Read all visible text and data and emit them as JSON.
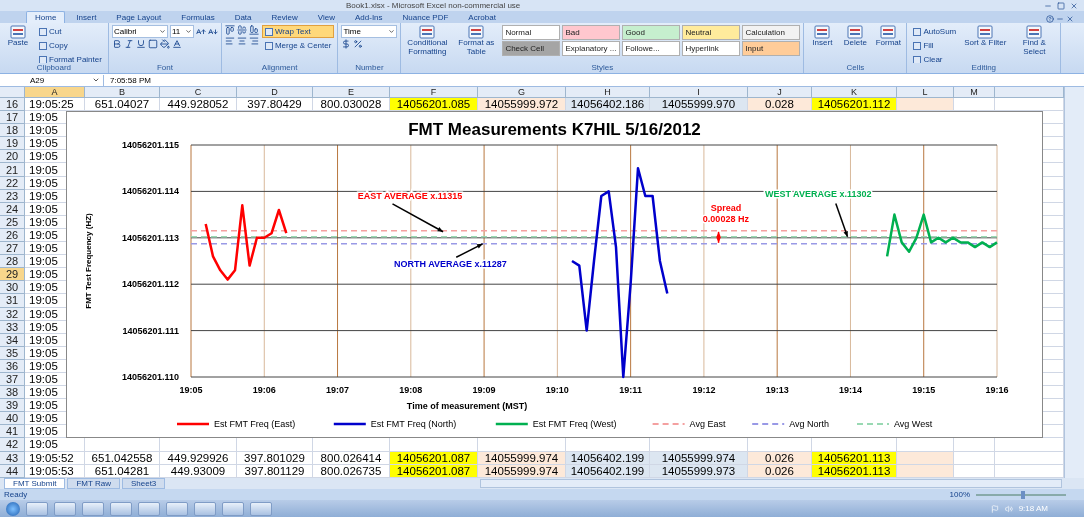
{
  "window": {
    "title": "Book1.xlsx - Microsoft Excel non-commercial use"
  },
  "ribbon": {
    "tabs": [
      {
        "label": "Home",
        "selected": true
      },
      {
        "label": "Insert",
        "selected": false
      },
      {
        "label": "Page Layout",
        "selected": false
      },
      {
        "label": "Formulas",
        "selected": false
      },
      {
        "label": "Data",
        "selected": false
      },
      {
        "label": "Review",
        "selected": false
      },
      {
        "label": "View",
        "selected": false
      },
      {
        "label": "Add-Ins",
        "selected": false
      },
      {
        "label": "Nuance PDF",
        "selected": false
      },
      {
        "label": "Acrobat",
        "selected": false
      }
    ],
    "groups": [
      {
        "label": "Clipboard",
        "items": [
          {
            "kind": "large",
            "label": "Paste"
          },
          {
            "kind": "stack",
            "children": [
              {
                "kind": "small",
                "label": "Cut"
              },
              {
                "kind": "small",
                "label": "Copy"
              },
              {
                "kind": "small",
                "label": "Format Painter"
              }
            ]
          }
        ]
      },
      {
        "label": "Font",
        "items": [
          {
            "kind": "stack",
            "children": [
              {
                "kind": "row",
                "children": [
                  {
                    "kind": "field",
                    "value": "Calibri",
                    "wide": true
                  },
                  {
                    "kind": "field",
                    "value": "11",
                    "wide": false
                  },
                  {
                    "kind": "grow_icons"
                  }
                ]
              },
              {
                "kind": "font_icons"
              }
            ]
          }
        ]
      },
      {
        "label": "Alignment",
        "items": [
          {
            "kind": "stack",
            "children": [
              {
                "kind": "valign_icons"
              },
              {
                "kind": "halign_icons"
              }
            ]
          },
          {
            "kind": "stack",
            "children": [
              {
                "kind": "small",
                "label": "Wrap Text",
                "on": true
              },
              {
                "kind": "small",
                "label": "Merge & Center",
                "on": false
              }
            ]
          }
        ]
      },
      {
        "label": "Number",
        "items": [
          {
            "kind": "stack",
            "children": [
              {
                "kind": "field",
                "value": "Time",
                "wide": true
              },
              {
                "kind": "number_icons"
              }
            ]
          }
        ]
      },
      {
        "label": "Styles",
        "items": [
          {
            "kind": "large",
            "label": "Conditional Formatting"
          },
          {
            "kind": "large",
            "label": "Format as Table"
          },
          {
            "kind": "stack",
            "children": [
              {
                "kind": "row",
                "children": [
                  {
                    "kind": "style",
                    "label": "Normal",
                    "color": "#ffffff"
                  },
                  {
                    "kind": "style",
                    "label": "Bad",
                    "color": "#ffc7ce"
                  },
                  {
                    "kind": "style",
                    "label": "Good",
                    "color": "#c6efce"
                  },
                  {
                    "kind": "style",
                    "label": "Neutral",
                    "color": "#ffeb9c"
                  },
                  {
                    "kind": "style",
                    "label": "Calculation",
                    "color": "#f2f2f2"
                  }
                ]
              },
              {
                "kind": "row",
                "children": [
                  {
                    "kind": "style",
                    "label": "Check Cell",
                    "color": "#a5a5a5"
                  },
                  {
                    "kind": "style",
                    "label": "Explanatory ...",
                    "color": "#ffffff"
                  },
                  {
                    "kind": "style",
                    "label": "Followe...",
                    "color": "#ffffff"
                  },
                  {
                    "kind": "style",
                    "label": "Hyperlink",
                    "color": "#ffffff"
                  },
                  {
                    "kind": "style",
                    "label": "Input",
                    "color": "#ffcc99"
                  }
                ]
              }
            ]
          }
        ]
      },
      {
        "label": "Cells",
        "items": [
          {
            "kind": "large",
            "label": "Insert"
          },
          {
            "kind": "large",
            "label": "Delete"
          },
          {
            "kind": "large",
            "label": "Format"
          }
        ]
      },
      {
        "label": "Editing",
        "items": [
          {
            "kind": "stack",
            "children": [
              {
                "kind": "small",
                "label": "AutoSum"
              },
              {
                "kind": "small",
                "label": "Fill"
              },
              {
                "kind": "small",
                "label": "Clear"
              }
            ]
          },
          {
            "kind": "large",
            "label": "Sort & Filter"
          },
          {
            "kind": "large",
            "label": "Find & Select"
          }
        ]
      }
    ]
  },
  "formula_bar": {
    "name_box": "A29",
    "formula": "7:05:58 PM"
  },
  "sheet": {
    "columns": [
      {
        "letter": "A",
        "selected": true
      },
      {
        "letter": "B",
        "selected": false
      },
      {
        "letter": "C",
        "selected": false
      },
      {
        "letter": "D",
        "selected": false
      },
      {
        "letter": "E",
        "selected": false
      },
      {
        "letter": "F",
        "selected": false,
        "color": "#ffff00"
      },
      {
        "letter": "G",
        "selected": false,
        "color": "#fde9d9"
      },
      {
        "letter": "H",
        "selected": false,
        "color": "#dce6f1"
      },
      {
        "letter": "I",
        "selected": false,
        "color": "#dce6f1"
      },
      {
        "letter": "J",
        "selected": false,
        "color": "#fde9d9"
      },
      {
        "letter": "K",
        "selected": false,
        "color": "#ffff00"
      },
      {
        "letter": "L",
        "selected": false,
        "color": "#fde9d9"
      },
      {
        "letter": "M",
        "selected": false
      }
    ],
    "rows": [
      {
        "number": "16",
        "selected": false,
        "cells": [
          "19:05:25",
          "651.04027",
          "449.928052",
          "397.80429",
          "800.030028",
          "14056201.085",
          "14055999.972",
          "14056402.186",
          "14055999.970",
          "0.028",
          "14056201.112"
        ]
      },
      {
        "number": "17",
        "selected": false,
        "cells": [
          "19:05"
        ]
      },
      {
        "number": "18",
        "selected": false,
        "cells": [
          "19:05"
        ]
      },
      {
        "number": "19",
        "selected": false,
        "cells": [
          "19:05"
        ]
      },
      {
        "number": "20",
        "selected": false,
        "cells": [
          "19:05"
        ]
      },
      {
        "number": "21",
        "selected": false,
        "cells": [
          "19:05"
        ]
      },
      {
        "number": "22",
        "selected": false,
        "cells": [
          "19:05"
        ]
      },
      {
        "number": "23",
        "selected": false,
        "cells": [
          "19:05"
        ]
      },
      {
        "number": "24",
        "selected": false,
        "cells": [
          "19:05"
        ]
      },
      {
        "number": "25",
        "selected": false,
        "cells": [
          "19:05"
        ]
      },
      {
        "number": "26",
        "selected": false,
        "cells": [
          "19:05"
        ]
      },
      {
        "number": "27",
        "selected": false,
        "cells": [
          "19:05"
        ]
      },
      {
        "number": "28",
        "selected": false,
        "cells": [
          "19:05"
        ]
      },
      {
        "number": "29",
        "selected": true,
        "cells": [
          "19:05"
        ]
      },
      {
        "number": "30",
        "selected": false,
        "cells": [
          "19:05"
        ]
      },
      {
        "number": "31",
        "selected": false,
        "cells": [
          "19:05"
        ]
      },
      {
        "number": "32",
        "selected": false,
        "cells": [
          "19:05"
        ]
      },
      {
        "number": "33",
        "selected": false,
        "cells": [
          "19:05"
        ]
      },
      {
        "number": "34",
        "selected": false,
        "cells": [
          "19:05"
        ]
      },
      {
        "number": "35",
        "selected": false,
        "cells": [
          "19:05"
        ]
      },
      {
        "number": "36",
        "selected": false,
        "cells": [
          "19:05"
        ]
      },
      {
        "number": "37",
        "selected": false,
        "cells": [
          "19:05"
        ]
      },
      {
        "number": "38",
        "selected": false,
        "cells": [
          "19:05"
        ]
      },
      {
        "number": "39",
        "selected": false,
        "cells": [
          "19:05"
        ]
      },
      {
        "number": "40",
        "selected": false,
        "cells": [
          "19:05"
        ]
      },
      {
        "number": "41",
        "selected": false,
        "cells": [
          "19:05"
        ]
      },
      {
        "number": "42",
        "selected": false,
        "cells": [
          "19:05"
        ]
      },
      {
        "number": "43",
        "selected": false,
        "cells": [
          "19:05:52",
          "651.042558",
          "449.929926",
          "397.801029",
          "800.026414",
          "14056201.087",
          "14055999.974",
          "14056402.199",
          "14055999.974",
          "0.026",
          "14056201.113"
        ]
      },
      {
        "number": "44",
        "selected": false,
        "cells": [
          "19:05:53",
          "651.04281",
          "449.93009",
          "397.801129",
          "800.026735",
          "14056201.087",
          "14055999.974",
          "14056402.199",
          "14055999.973",
          "0.026",
          "14056201.113"
        ]
      }
    ],
    "chart_data": {
      "type": "line",
      "title": "FMT Measurements K7HIL 5/16/2012",
      "xlabel": "Time of measurement (MST)",
      "ylabel": "FMT Test Frequency (HZ)",
      "grid": true,
      "legend": "bottom",
      "ylim": [
        14056201.11,
        14056201.115
      ],
      "categories": [
        "19:05",
        null,
        null,
        null,
        null,
        null,
        null,
        null,
        null,
        null,
        "19:06",
        null,
        null,
        null,
        null,
        null,
        null,
        null,
        null,
        null,
        "19:07",
        null,
        null,
        null,
        null,
        null,
        null,
        null,
        null,
        null,
        "19:08",
        null,
        null,
        null,
        null,
        null,
        null,
        null,
        null,
        null,
        "19:09",
        null,
        null,
        null,
        null,
        null,
        null,
        null,
        null,
        null,
        "19:10",
        null,
        null,
        null,
        null,
        null,
        null,
        null,
        null,
        null,
        "19:11",
        null,
        null,
        null,
        null,
        null,
        null,
        null,
        null,
        null,
        "19:12",
        null,
        null,
        null,
        null,
        null,
        null,
        null,
        null,
        null,
        "19:13",
        null,
        null,
        null,
        null,
        null,
        null,
        null,
        null,
        null,
        "19:14",
        null,
        null,
        null,
        null,
        null,
        null,
        null,
        null,
        null,
        "19:15",
        null,
        null,
        null,
        null,
        null,
        null,
        null,
        null,
        null,
        "19:16"
      ],
      "yticks": [
        {
          "value": 14056201.11,
          "label": "14056201.110"
        },
        {
          "value": 14056201.111,
          "label": "14056201.111"
        },
        {
          "value": 14056201.112,
          "label": "14056201.112"
        },
        {
          "value": 14056201.113,
          "label": "14056201.113"
        },
        {
          "value": 14056201.114,
          "label": "14056201.114"
        },
        {
          "value": 14056201.115,
          "label": "14056201.115"
        }
      ],
      "series": [
        {
          "name": "Est FMT Freq (East)",
          "color": "#ff0000",
          "values": [
            null,
            null,
            14056201.1133,
            14056201.1126,
            14056201.1123,
            14056201.1121,
            14056201.1123,
            14056201.1137,
            14056201.1124,
            14056201.113,
            14056201.113,
            14056201.1131,
            14056201.1136,
            14056201.1131,
            null,
            null,
            null,
            null,
            null,
            null,
            null,
            null,
            null,
            null,
            null,
            null,
            null,
            null,
            null,
            null,
            null,
            null,
            null,
            null,
            null,
            null,
            null,
            null,
            null,
            null,
            null,
            null,
            null,
            null,
            null,
            null,
            null,
            null,
            null,
            null,
            null,
            null,
            null,
            null,
            null,
            null,
            null,
            null,
            null,
            null,
            null,
            null,
            null,
            null,
            null,
            null,
            null,
            null,
            null,
            null,
            null,
            null,
            null,
            null,
            null,
            null,
            null,
            null,
            null,
            null,
            null,
            null,
            null,
            null,
            null,
            null,
            null,
            null,
            null,
            null,
            null,
            null,
            null,
            null,
            null,
            null,
            null,
            null,
            null,
            null,
            null,
            null,
            null,
            null,
            null,
            null,
            null,
            null,
            null,
            null,
            null
          ]
        },
        {
          "name": "Est FMT Freq (North)",
          "color": "#0000cc",
          "values": [
            null,
            null,
            null,
            null,
            null,
            null,
            null,
            null,
            null,
            null,
            null,
            null,
            null,
            null,
            null,
            null,
            null,
            null,
            null,
            null,
            null,
            null,
            null,
            null,
            null,
            null,
            null,
            null,
            null,
            null,
            null,
            null,
            null,
            null,
            null,
            null,
            null,
            null,
            null,
            null,
            null,
            null,
            null,
            null,
            null,
            null,
            null,
            null,
            null,
            null,
            null,
            null,
            14056201.1125,
            14056201.1124,
            14056201.111,
            14056201.1125,
            14056201.1139,
            14056201.114,
            14056201.1128,
            14056201.11,
            14056201.112,
            14056201.1145,
            14056201.1139,
            14056201.1139,
            14056201.1125,
            14056201.1118,
            null,
            null,
            null,
            null,
            null,
            null,
            null,
            null,
            null,
            null,
            null,
            null,
            null,
            null,
            null,
            null,
            null,
            null,
            null,
            null,
            null,
            null,
            null,
            null,
            null,
            null,
            null,
            null,
            null,
            null,
            null,
            null,
            null,
            null,
            null,
            null,
            null,
            null,
            null,
            null,
            null,
            null,
            null,
            null,
            null
          ]
        },
        {
          "name": "Est FMT Freq (West)",
          "color": "#00b050",
          "values": [
            null,
            null,
            null,
            null,
            null,
            null,
            null,
            null,
            null,
            null,
            null,
            null,
            null,
            null,
            null,
            null,
            null,
            null,
            null,
            null,
            null,
            null,
            null,
            null,
            null,
            null,
            null,
            null,
            null,
            null,
            null,
            null,
            null,
            null,
            null,
            null,
            null,
            null,
            null,
            null,
            null,
            null,
            null,
            null,
            null,
            null,
            null,
            null,
            null,
            null,
            null,
            null,
            null,
            null,
            null,
            null,
            null,
            null,
            null,
            null,
            null,
            null,
            null,
            null,
            null,
            null,
            null,
            null,
            null,
            null,
            null,
            null,
            null,
            null,
            null,
            null,
            null,
            null,
            null,
            null,
            null,
            null,
            null,
            null,
            null,
            null,
            null,
            null,
            null,
            null,
            null,
            null,
            null,
            null,
            null,
            14056201.1126,
            14056201.1135,
            14056201.1129,
            14056201.1127,
            14056201.113,
            14056201.1135,
            14056201.1129,
            14056201.113,
            14056201.1129,
            14056201.113,
            14056201.1129,
            14056201.1129,
            14056201.1128,
            14056201.1129,
            14056201.1128,
            14056201.1129
          ]
        }
      ],
      "ref_lines": [
        {
          "axis": "y",
          "value": 14056201.11315,
          "label": "Avg East",
          "color": "#f4a0a0"
        },
        {
          "axis": "y",
          "value": 14056201.11287,
          "label": "Avg North",
          "color": "#9999e6"
        },
        {
          "axis": "y",
          "value": 14056201.11302,
          "label": "Avg West",
          "color": "#99d9b3"
        }
      ],
      "annotations": [
        "EAST AVERAGE x.11315",
        "NORTH AVERAGE x.11287",
        "Spread",
        "0.00028 Hz",
        "WEST AVERAGE x.11302"
      ]
    }
  },
  "sheet_tabs": [
    {
      "label": "FMT Submit",
      "selected": true
    },
    {
      "label": "FMT Raw",
      "selected": false
    },
    {
      "label": "Sheet3",
      "selected": false
    }
  ],
  "status_bar": {
    "text": "Ready",
    "zoom": "100%",
    "zoom_slider": {
      "level": 0.5
    }
  },
  "taskbar": {
    "clock": "9:18 AM"
  }
}
